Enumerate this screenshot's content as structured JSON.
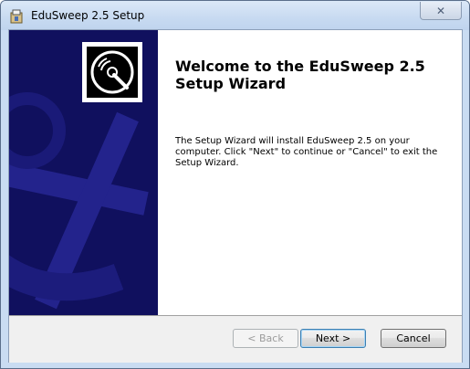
{
  "window": {
    "title": "EduSweep 2.5 Setup",
    "close_symbol": "✕"
  },
  "content": {
    "heading": "Welcome to the EduSweep 2.5 Setup Wizard",
    "description": "The Setup Wizard will install EduSweep 2.5 on your computer.  Click \"Next\" to continue or \"Cancel\" to exit the Setup Wizard."
  },
  "buttons": {
    "back": "< Back",
    "next": "Next >",
    "cancel": "Cancel"
  },
  "colors": {
    "banner": "#10105e",
    "banner_accent": "#2b2b9e"
  },
  "icons": {
    "app": "installer-package-icon",
    "logo": "disc-sweep-logo-icon"
  }
}
